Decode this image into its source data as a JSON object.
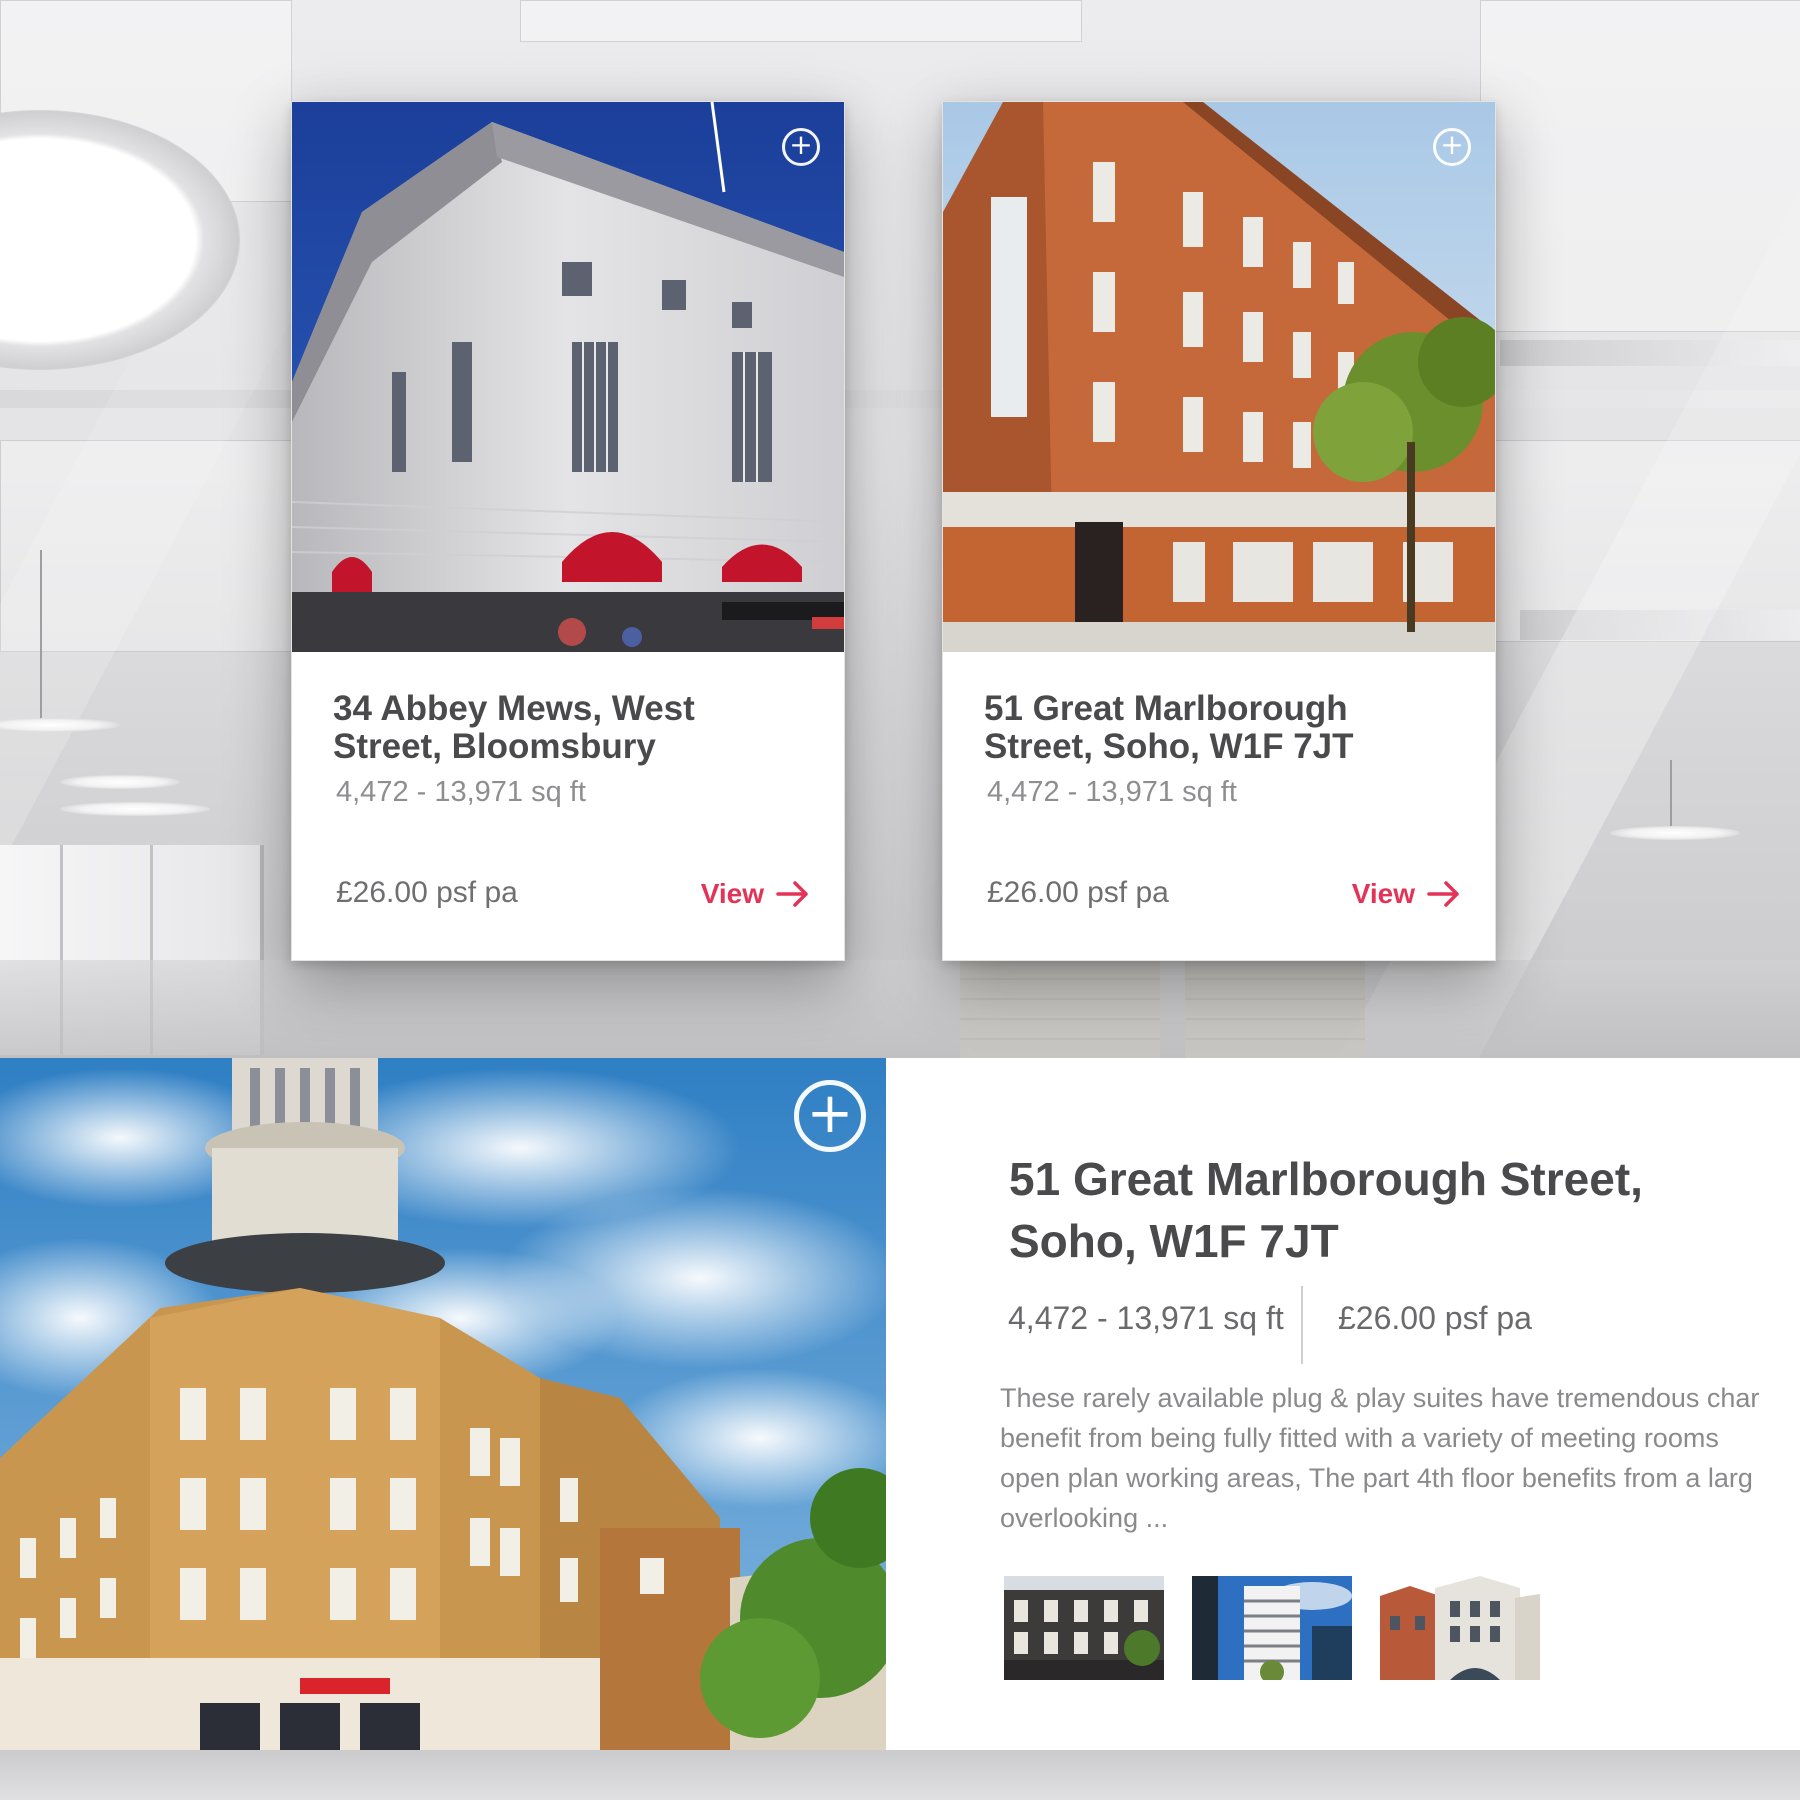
{
  "cards": [
    {
      "title_line1": "34 Abbey Mews, West",
      "title_line2": "Street, Bloomsbury",
      "size": "4,472 - 13,971 sq ft",
      "price": "£26.00 psf pa",
      "view_label": "View",
      "add_symbol": "+"
    },
    {
      "title_line1": "51 Great Marlborough",
      "title_line2": "Street, Soho, W1F 7JT",
      "size": "4,472 - 13,971 sq ft",
      "price": "£26.00 psf pa",
      "view_label": "View",
      "add_symbol": "+"
    }
  ],
  "detail": {
    "title_line1": "51 Great Marlborough Street,",
    "title_line2": "Soho, W1F 7JT",
    "size": "4,472 - 13,971 sq ft",
    "price": "£26.00 psf pa",
    "description_lines": [
      "These rarely available plug & play suites have tremendous char",
      "benefit from being fully fitted with a variety of meeting rooms",
      "open plan working areas, The part 4th floor benefits from a larg",
      "overlooking ..."
    ],
    "add_symbol": "+"
  },
  "icons": {
    "add": "plus-circle-icon",
    "view_arrow": "arrow-right-icon"
  },
  "colors": {
    "accent": "#e33458",
    "title_text": "#4a4a4c",
    "muted_text": "#8e8e90"
  }
}
